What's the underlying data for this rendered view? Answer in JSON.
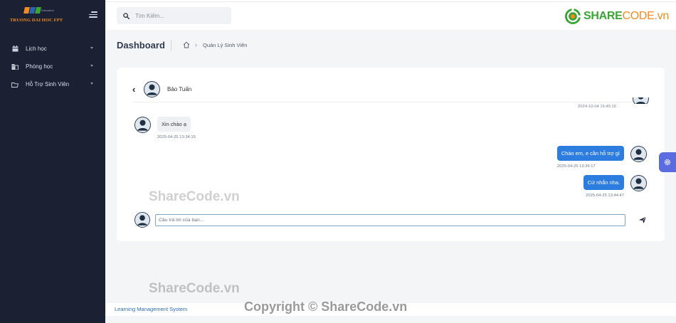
{
  "brand": {
    "logo_text": "TRUONG DAI HOC FPT",
    "logo_sub": "Education",
    "logo_colors": [
      "#f58a1f",
      "#2b63b8",
      "#3aa535"
    ],
    "site_logo_part1": "SHARE",
    "site_logo_part2": "CODE.vn"
  },
  "sidebar": {
    "items": [
      {
        "label": "Lịch học",
        "icon": "calendar-icon"
      },
      {
        "label": "Phòng học",
        "icon": "building-icon"
      },
      {
        "label": "Hỗ Trợ Sinh Viên",
        "icon": "support-icon"
      }
    ]
  },
  "search": {
    "placeholder": "Tìm Kiếm..."
  },
  "header": {
    "title": "Dashboard",
    "breadcrumb": [
      "Quản Lý Sinh Viên"
    ]
  },
  "chat": {
    "contact_name": "Bảo Tuấn",
    "cut_timestamp": "2024-10-04 15:45:16",
    "messages": [
      {
        "direction": "in",
        "text": "Xin chào ạ",
        "time": "2025-04-25 13:34:15"
      },
      {
        "direction": "out",
        "text": "Chào em, e cần hỗ trợ gì",
        "time": "2025-04-25 13:35:17"
      },
      {
        "direction": "out",
        "text": "Cứ nhắn nha.",
        "time": "2025-04-25 13:44:47"
      }
    ],
    "input_placeholder": "Câu trả lời của bạn..."
  },
  "watermarks": [
    "ShareCode.vn",
    "ShareCode.vn",
    "Copyright © ShareCode.vn"
  ],
  "footer": {
    "text": "Learning Management System"
  },
  "colors": {
    "sidebar_bg": "#1b2033",
    "accent": "#2d7de0",
    "settings_tab": "#5a6ce0"
  }
}
